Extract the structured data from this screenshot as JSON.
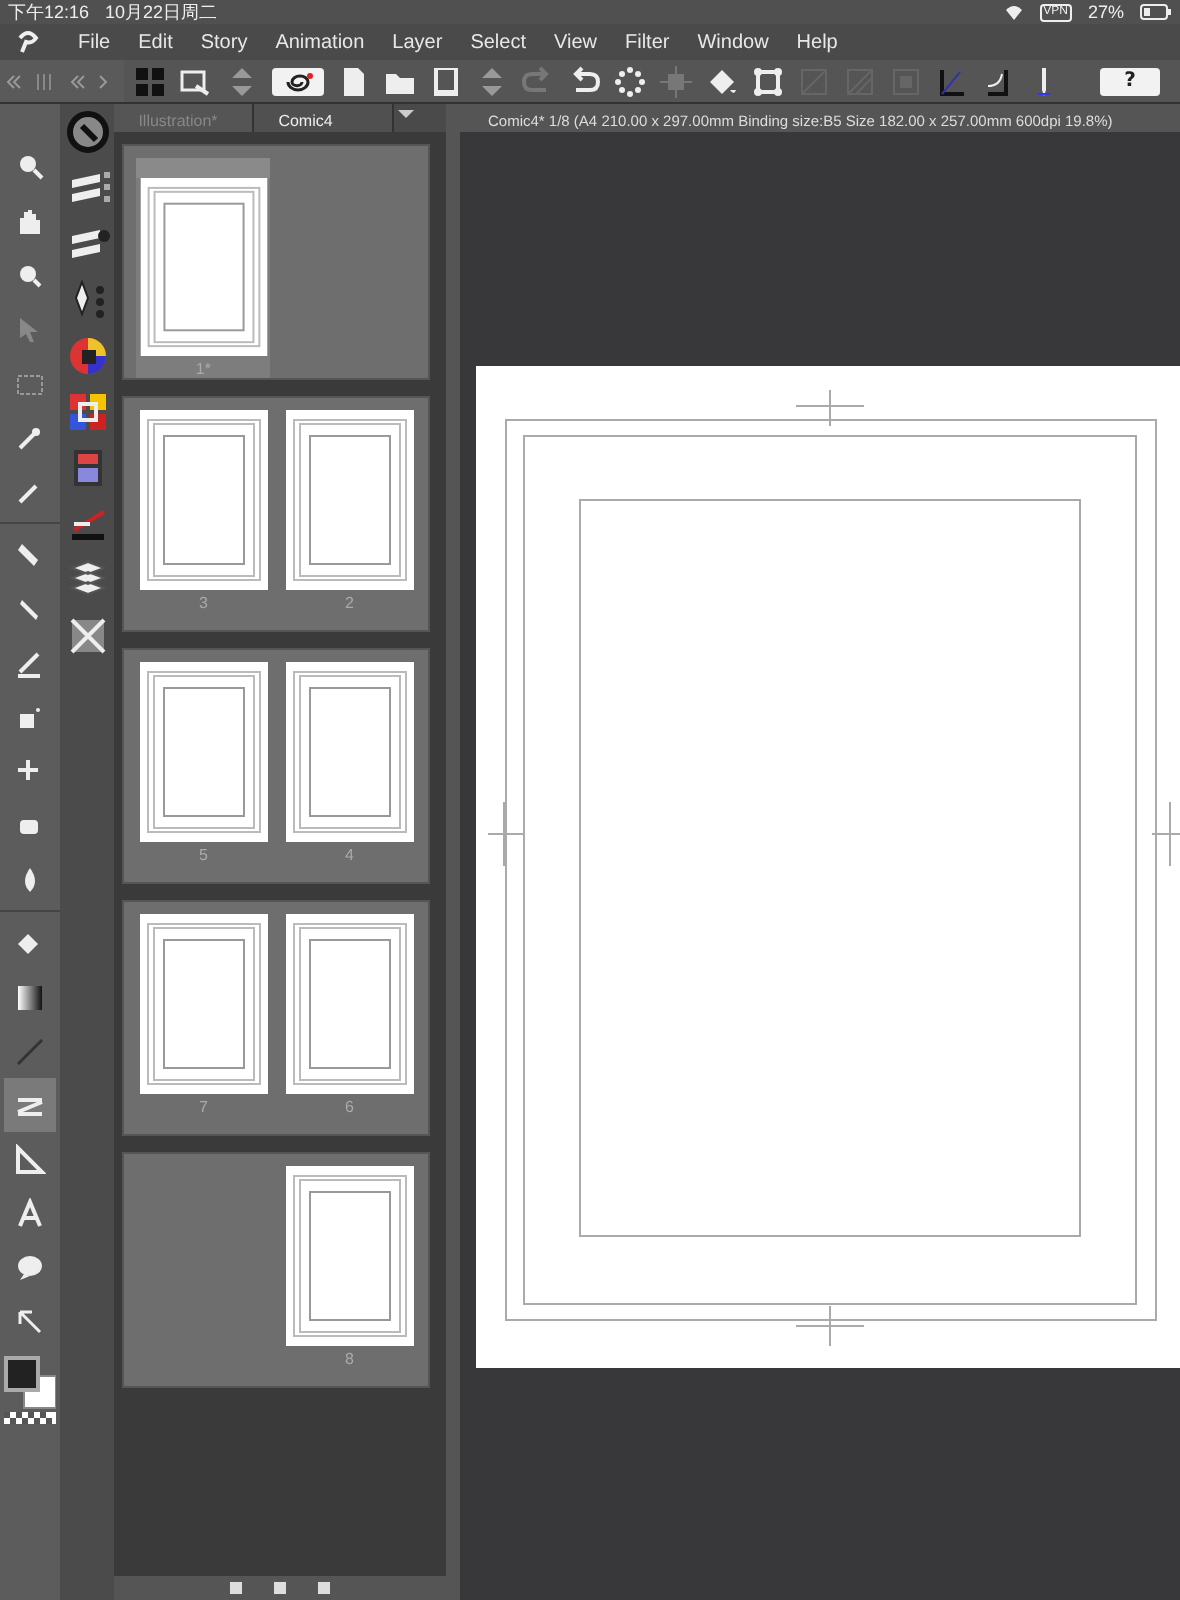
{
  "status_bar": {
    "time": "下午12:16",
    "date": "10月22日周二",
    "vpn": "VPN",
    "battery": "27%"
  },
  "menu": [
    "File",
    "Edit",
    "Story",
    "Animation",
    "Layer",
    "Select",
    "View",
    "Filter",
    "Window",
    "Help"
  ],
  "toolbar": {
    "help_label": "?"
  },
  "tools": [
    {
      "selected": false
    },
    {
      "selected": false
    },
    {
      "selected": false
    },
    {
      "selected": false
    },
    {
      "selected": false
    },
    {
      "selected": false
    },
    {
      "selected": false
    },
    {
      "selected": false
    },
    {
      "selected": false
    },
    {
      "selected": false
    },
    {
      "selected": false
    },
    {
      "selected": false
    },
    {
      "selected": false
    },
    {
      "selected": false
    },
    {
      "selected": false
    },
    {
      "selected": false
    },
    {
      "selected": false
    },
    {
      "selected": true
    },
    {
      "selected": false
    },
    {
      "selected": false
    },
    {
      "selected": false
    },
    {
      "selected": false
    }
  ],
  "panel_tabs": [
    {
      "label": "Illustration*",
      "selected": false
    },
    {
      "label": "Comic4",
      "selected": true
    }
  ],
  "document_tab": {
    "title": "Comic4* 1/8 (A4 210.00 x 297.00mm Binding size:B5 Size 182.00 x 257.00mm 600dpi 19.8%)"
  },
  "spreads": [
    {
      "slots": [
        {
          "kind": "page",
          "label": "1*",
          "selected": true
        },
        {
          "kind": "empty"
        }
      ]
    },
    {
      "slots": [
        {
          "kind": "page",
          "label": "3",
          "selected": false
        },
        {
          "kind": "page",
          "label": "2",
          "selected": false
        }
      ]
    },
    {
      "slots": [
        {
          "kind": "page",
          "label": "5",
          "selected": false
        },
        {
          "kind": "page",
          "label": "4",
          "selected": false
        }
      ]
    },
    {
      "slots": [
        {
          "kind": "page",
          "label": "7",
          "selected": false
        },
        {
          "kind": "page",
          "label": "6",
          "selected": false
        }
      ]
    },
    {
      "slots": [
        {
          "kind": "empty"
        },
        {
          "kind": "page",
          "label": "8",
          "selected": false
        }
      ]
    }
  ]
}
